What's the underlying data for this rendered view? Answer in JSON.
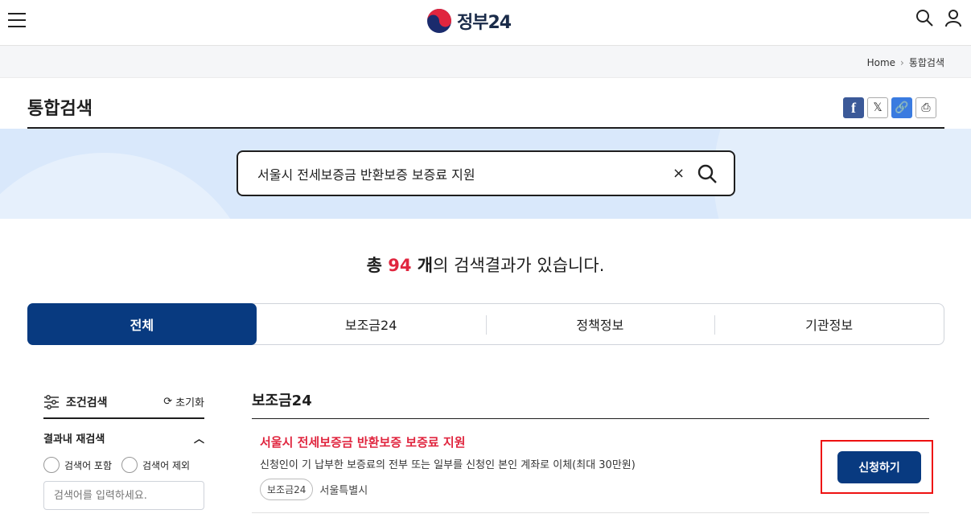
{
  "header": {
    "logo_text": "정부24",
    "icons": [
      "menu-icon",
      "search-icon",
      "user-icon"
    ]
  },
  "breadcrumb": {
    "home": "Home",
    "current": "통합검색"
  },
  "page": {
    "title": "통합검색",
    "share_icons": [
      "facebook-icon",
      "x-icon",
      "link-icon",
      "print-icon"
    ]
  },
  "search": {
    "query": "서울시 전세보증금 반환보증 보증료 지원",
    "clear": "×"
  },
  "result": {
    "prefix": "총 ",
    "count": "94",
    "unit": " 개",
    "suffix": "의 검색결과가 있습니다."
  },
  "tabs": [
    {
      "label": "전체",
      "active": true
    },
    {
      "label": "보조금24",
      "active": false
    },
    {
      "label": "정책정보",
      "active": false
    },
    {
      "label": "기관정보",
      "active": false
    }
  ],
  "sidebar": {
    "title": "조건검색",
    "reset": "초기화",
    "refine_title": "결과내 재검색",
    "include_label": "검색어 포함",
    "exclude_label": "검색어 제외",
    "input_placeholder": "검색어를 입력하세요."
  },
  "section": {
    "title": "보조금24",
    "items": [
      {
        "title": "서울시 전세보증금 반환보증 보증료 지원",
        "description": "신청인이 기 납부한 보증료의 전부 또는 일부를 신청인 본인 계좌로 이체(최대 30만원)",
        "tag": "보조금24",
        "agency": "서울특별시",
        "button": "신청하기"
      }
    ]
  },
  "colors": {
    "primary": "#083a80",
    "accent_red": "#e0263f",
    "hero_bg": "#d9e8fb"
  }
}
